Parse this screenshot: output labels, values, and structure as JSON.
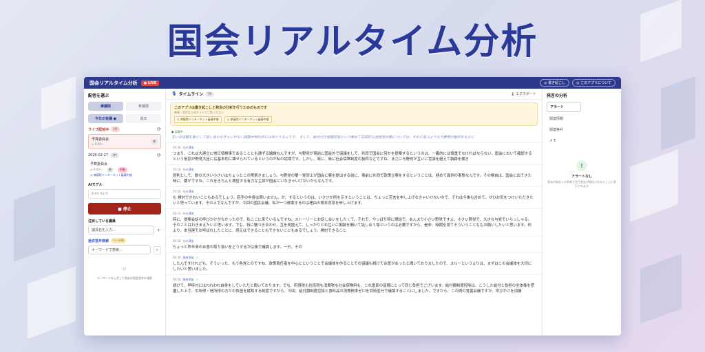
{
  "hero": {
    "title": "国会リアルタイム分析"
  },
  "app": {
    "title": "国会リアルタイム分析",
    "live_badge": "● LIVE",
    "btn_transcribe": "◎ 書き起こし",
    "btn_about": "◎ このアプリについて"
  },
  "sidebar": {
    "section_title": "配信を選ぶ",
    "house_tabs": [
      "衆議院",
      "参議院"
    ],
    "mode_tabs": [
      "今日の会議 ●",
      "過去"
    ],
    "live_header": "ライブ配信中",
    "live_count": "1件",
    "live_item": {
      "name": "予算委員会",
      "sub": "◎ 9:00〜",
      "badge": "衆"
    },
    "date_header": "2026-02-27",
    "date_count": "1件",
    "date_item": {
      "name": "予算委員会",
      "sub_a": "◎ 9:00〜",
      "sub_b": "衆",
      "sub_c": "中継",
      "sub_link": "◎ 衆議院インターネット審議中継"
    },
    "ai_model_label": "AIモデル",
    "ai_model_value": "Kimi K2.5",
    "stop_button": "■ 停止",
    "watch_label": "注目している議員",
    "watch_placeholder": "議員名を入力...",
    "search_label": "過去答弁検索",
    "search_beta": "ベータ版",
    "search_placeholder": "キーワードで検索...",
    "search_hint": "キーワードを入力して過去の国会答弁を検索"
  },
  "timeline": {
    "title": "タイムライン",
    "count": "7件",
    "export": "エクスポート",
    "notice_title": "このアプリは書き起こしと発言の分析を行うためのものです",
    "notice_sub": "映像・音声は公式サイトでご覧ください",
    "notice_links": [
      "◎ 衆議院インターネット審議中継",
      "◎ 参議院インターネット審議中継"
    ],
    "live_label": "● 認識中",
    "live_text": "互いの信頼を築として話し合わなきゃいけない課題が例外的にはありうるんです。 そして、給付付き税額控除という極めて長期的な迷惑性対策については、それに並ぶような与野党の動的をもとに",
    "utterances": [
      {
        "time": "04:38",
        "speaker": "小川淳也",
        "check": "",
        "text": "つまり、これは大連立に常日頃検事であることとも通ずる議論なんですが、与野党が事前に国会外で協議をして、共同で国会に何かを提案するというのは、一義的には慎重でなければならない。国会において確認するという役割が野党大臣には基本的に課せられているというのが私の認識です。しかし、時に、時に社会保障制度の抜粋などですね、まさに与野党が互いに覚演を超えて胸跡を擱き"
      },
      {
        "time": "05:18",
        "speaker": "小川淳也",
        "check": "",
        "text": "原則として、数の大きい小さいはちょっとこの際置きましょう。与野党の第一党同士が国会に案を提出する前に、事前に共同で政策立案をするということは、極めて異例の事態なんです。その幌自は、国会に出てきた時に、要がですね、これをきちんと検証する有力な主体が国会にいなきゃいけないからなんです。"
      },
      {
        "time": "05:50",
        "speaker": "小川淳也",
        "check": "",
        "text": "も 検討できないこともあるでしょう。若手の中身は問いません。が、するというのは、いささか例を示すということは、ちょっと苦言を申し上げなきゃいけないので、それは今後も含めて。ぜひお気をつけいただきたいと思っています。その上でなんですが、今回の国民会議、私が一つ懸案するのは理由の根本背景を申し上げます。"
      },
      {
        "time": "06:19",
        "speaker": "小川淳也",
        "check": "",
        "text": "時に、提案会話の呼びかけがなかったので、私ここに来ているんですね。ストーリーとお話し合いをしたくて。それで、やっぱり時に競話で、あんまり小さい野党ですよ。小さい野党で、大きな与党でいらっしゃる。 そのことはわきまえたいと思います。でも、特に勝つき合わせ、互を見据えて、しっかりとお互いに胸跡を開いて話し合う場というのは必要ですから、是非、時期を見てそういうことももお願いしたいと思います。判より、本当連でお呼ばれしたことに、例えはできることもできないこともあるでしょう。検討できること"
      },
      {
        "time": "06:30",
        "speaker": "小川淳也",
        "check": "",
        "text": "ちょっと昨年来の合意の取り扱いをどうするかは後で議論します。一方、その"
      },
      {
        "time": "06:36",
        "speaker": "高市早苗",
        "check": "✓",
        "text": "したんですけれども、そういった、もう各党とのですね、政策責任者を中心にということで会議体を作ることでの協議も続けて合意があったと聞いておりましたので、スルーというよりは、まずはこの会議体を大切にしたいと思いました。"
      },
      {
        "time": "06:58",
        "speaker": "高市早苗",
        "check": "✓",
        "text": "続けて、早特付にはわれわれ自身をしていただと聞いております。でも、所得税も住民税も消費税も社会保険料も、これ国民の皆様にとって同じ負担でございます。給付額制度控除は、こうした給付と負担の全体像を把握した上で、中所得・低所得の方々の負担を緩和する制度ですから、今回、給付額制度控除と食料品の消費税率ゼロを同時並行で議論することにしました。ですから、この間の覚書会議ですか、呼びかけを頂構"
      }
    ]
  },
  "right_panel": {
    "title": "発言の分析",
    "tabs": [
      "アラート",
      "関連情報",
      "関連答弁",
      "メモ"
    ],
    "empty_icon": "!",
    "empty_title": "アラートなし",
    "empty_sub": "過去の発言との矛盾や注目発言が検出されるとここに表示されます"
  },
  "colors": {
    "accent": "#2d3a8c",
    "stop": "#a42319",
    "live": "#e0483d"
  }
}
